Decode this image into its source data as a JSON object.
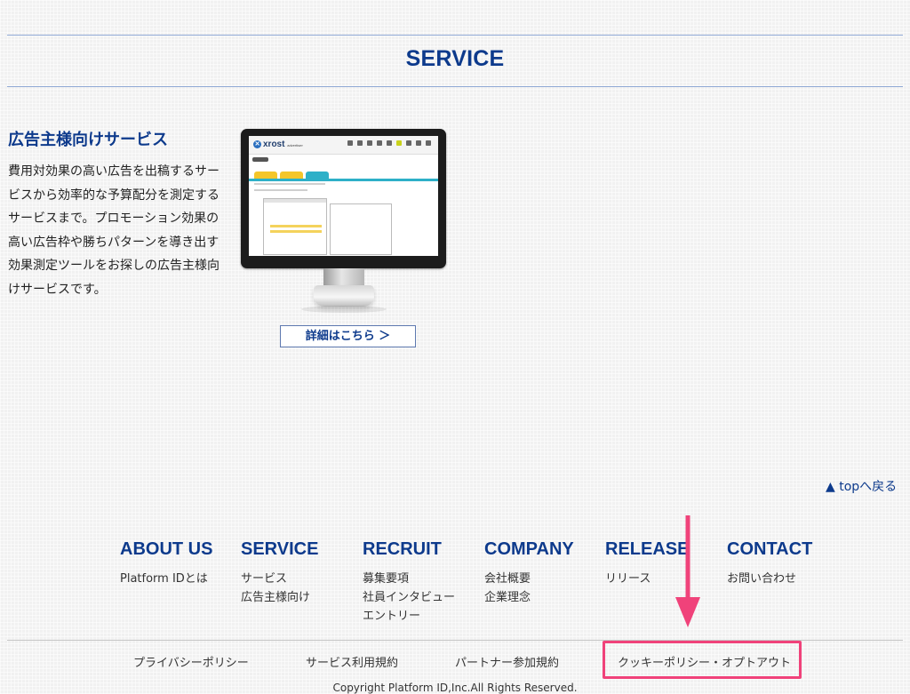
{
  "section": {
    "title": "SERVICE"
  },
  "service": {
    "heading": "広告主様向けサービス",
    "description": "費用対効果の高い広告を出稿するサービスから効率的な予算配分を測定するサービスまで。プロモーション効果の高い広告枠や勝ちパターンを導き出す効果測定ツールをお探しの広告主様向けサービスです。",
    "screen_logo": "xrost",
    "screen_logo_sub": "advertiser",
    "detail_button_label": "詳細はこちら ＞"
  },
  "to_top_label": "▲ topへ戻る",
  "footer_nav": [
    {
      "heading": "ABOUT US",
      "links": [
        "Platform IDとは"
      ]
    },
    {
      "heading": "SERVICE",
      "links": [
        "サービス",
        "広告主様向け"
      ]
    },
    {
      "heading": "RECRUIT",
      "links": [
        "募集要項",
        "社員インタビュー",
        "エントリー"
      ]
    },
    {
      "heading": "COMPANY",
      "links": [
        "会社概要",
        "企業理念"
      ]
    },
    {
      "heading": "RELEASE",
      "links": [
        "リリース"
      ]
    },
    {
      "heading": "CONTACT",
      "links": [
        "お問い合わせ"
      ]
    }
  ],
  "bottom_links": {
    "privacy": "プライバシーポリシー",
    "terms": "サービス利用規約",
    "partner": "パートナー参加規約",
    "cookie": "クッキーポリシー・オプトアウト"
  },
  "copyright": "Copyright Platform ID,Inc.All Rights Reserved.",
  "colors": {
    "brand_blue": "#0d3a8c",
    "annotation_pink": "#f0427a",
    "screen_tab_accent": "#2eb0c8"
  }
}
